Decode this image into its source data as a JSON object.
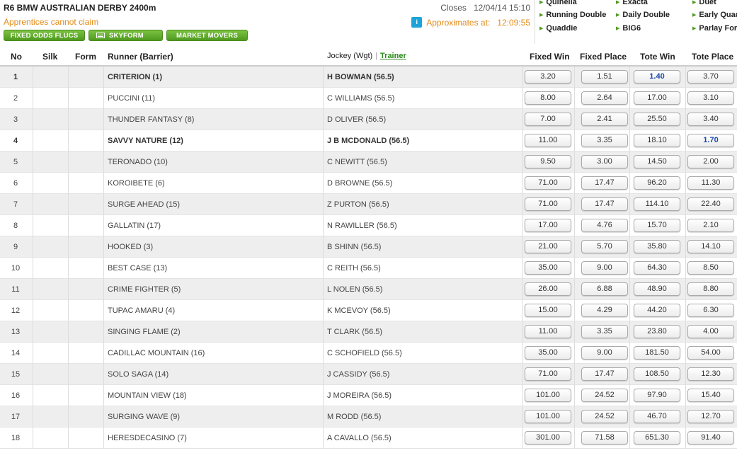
{
  "race": {
    "title": "R6 BMW AUSTRALIAN DERBY 2400m",
    "closes_label": "Closes",
    "closes_value": "12/04/14 15:10",
    "note": "Apprentices cannot claim",
    "approx_label": "Approximates at:",
    "approx_time": "12:09:55",
    "info_icon": "i"
  },
  "buttons": {
    "fixed_odds_flucs": "FIXED ODDS FLUCS",
    "skyform": "SKYFORM",
    "market_movers": "MARKET MOVERS"
  },
  "exotics": {
    "arrow": "▶",
    "items": [
      "Quinella",
      "Exacta",
      "Duet",
      "Running Double",
      "Daily Double",
      "Early Quad",
      "Quaddie",
      "BIG6",
      "Parlay For"
    ]
  },
  "columns": {
    "no": "No",
    "silk": "Silk",
    "form": "Form",
    "runner": "Runner (Barrier)",
    "jockey": "Jockey (Wgt)",
    "trainer": "Trainer",
    "sep": "|",
    "fixed_win": "Fixed Win",
    "fixed_place": "Fixed Place",
    "tote_win": "Tote Win",
    "tote_place": "Tote Place"
  },
  "colors": {
    "accent_green": "#4e9a1e",
    "note_orange": "#e38b1a",
    "info_blue": "#1ea3d8",
    "highlight_blue": "#1d4aa8"
  },
  "runners": [
    {
      "no": "1",
      "runner": "CRITERION (1)",
      "jockey": "H BOWMAN (56.5)",
      "fw": "3.20",
      "fp": "1.51",
      "tw": "1.40",
      "tp": "3.70",
      "bold": true,
      "hl": "tw"
    },
    {
      "no": "2",
      "runner": "PUCCINI (11)",
      "jockey": "C WILLIAMS (56.5)",
      "fw": "8.00",
      "fp": "2.64",
      "tw": "17.00",
      "tp": "3.10"
    },
    {
      "no": "3",
      "runner": "THUNDER FANTASY (8)",
      "jockey": "D OLIVER (56.5)",
      "fw": "7.00",
      "fp": "2.41",
      "tw": "25.50",
      "tp": "3.40"
    },
    {
      "no": "4",
      "runner": "SAVVY NATURE (12)",
      "jockey": "J B MCDONALD (56.5)",
      "fw": "11.00",
      "fp": "3.35",
      "tw": "18.10",
      "tp": "1.70",
      "bold": true,
      "hl": "tp"
    },
    {
      "no": "5",
      "runner": "TERONADO (10)",
      "jockey": "C NEWITT (56.5)",
      "fw": "9.50",
      "fp": "3.00",
      "tw": "14.50",
      "tp": "2.00"
    },
    {
      "no": "6",
      "runner": "KOROIBETE (6)",
      "jockey": "D BROWNE (56.5)",
      "fw": "71.00",
      "fp": "17.47",
      "tw": "96.20",
      "tp": "11.30"
    },
    {
      "no": "7",
      "runner": "SURGE AHEAD (15)",
      "jockey": "Z PURTON (56.5)",
      "fw": "71.00",
      "fp": "17.47",
      "tw": "114.10",
      "tp": "22.40"
    },
    {
      "no": "8",
      "runner": "GALLATIN (17)",
      "jockey": "N RAWILLER (56.5)",
      "fw": "17.00",
      "fp": "4.76",
      "tw": "15.70",
      "tp": "2.10"
    },
    {
      "no": "9",
      "runner": "HOOKED (3)",
      "jockey": "B SHINN (56.5)",
      "fw": "21.00",
      "fp": "5.70",
      "tw": "35.80",
      "tp": "14.10"
    },
    {
      "no": "10",
      "runner": "BEST CASE (13)",
      "jockey": "C REITH (56.5)",
      "fw": "35.00",
      "fp": "9.00",
      "tw": "64.30",
      "tp": "8.50"
    },
    {
      "no": "11",
      "runner": "CRIME FIGHTER (5)",
      "jockey": "L NOLEN (56.5)",
      "fw": "26.00",
      "fp": "6.88",
      "tw": "48.90",
      "tp": "8.80"
    },
    {
      "no": "12",
      "runner": "TUPAC AMARU (4)",
      "jockey": "K MCEVOY (56.5)",
      "fw": "15.00",
      "fp": "4.29",
      "tw": "44.20",
      "tp": "6.30"
    },
    {
      "no": "13",
      "runner": "SINGING FLAME (2)",
      "jockey": "T CLARK (56.5)",
      "fw": "11.00",
      "fp": "3.35",
      "tw": "23.80",
      "tp": "4.00"
    },
    {
      "no": "14",
      "runner": "CADILLAC MOUNTAIN (16)",
      "jockey": "C SCHOFIELD (56.5)",
      "fw": "35.00",
      "fp": "9.00",
      "tw": "181.50",
      "tp": "54.00"
    },
    {
      "no": "15",
      "runner": "SOLO SAGA (14)",
      "jockey": "J CASSIDY (56.5)",
      "fw": "71.00",
      "fp": "17.47",
      "tw": "108.50",
      "tp": "12.30"
    },
    {
      "no": "16",
      "runner": "MOUNTAIN VIEW (18)",
      "jockey": "J MOREIRA (56.5)",
      "fw": "101.00",
      "fp": "24.52",
      "tw": "97.90",
      "tp": "15.40"
    },
    {
      "no": "17",
      "runner": "SURGING WAVE (9)",
      "jockey": "M RODD (56.5)",
      "fw": "101.00",
      "fp": "24.52",
      "tw": "46.70",
      "tp": "12.70"
    },
    {
      "no": "18",
      "runner": "HERESDECASINO (7)",
      "jockey": "A CAVALLO (56.5)",
      "fw": "301.00",
      "fp": "71.58",
      "tw": "651.30",
      "tp": "91.40"
    }
  ]
}
